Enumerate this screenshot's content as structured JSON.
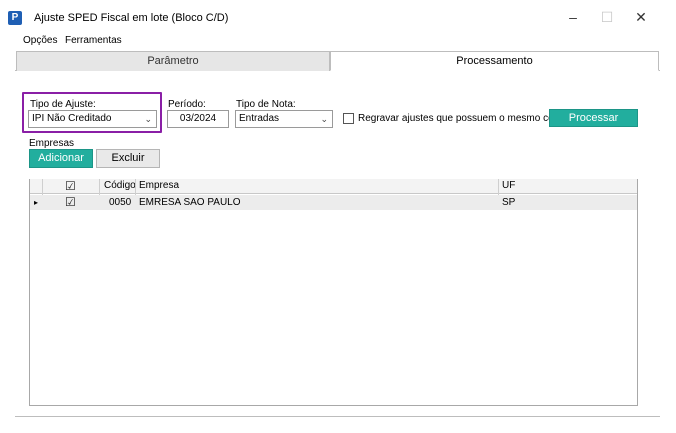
{
  "window": {
    "title": "Ajuste SPED Fiscal em lote (Bloco C/D)",
    "icon_glyph": "P",
    "controls": {
      "minimize": "–",
      "maximize": "☐",
      "close": "✕"
    }
  },
  "menu": {
    "items": [
      "Opções",
      "Ferramentas"
    ]
  },
  "tabs": [
    {
      "label": "Parâmetro",
      "active": false
    },
    {
      "label": "Processamento",
      "active": true
    }
  ],
  "form": {
    "tipo_ajuste": {
      "label": "Tipo de Ajuste:",
      "value": "IPI Não Creditado"
    },
    "periodo": {
      "label": "Período:",
      "value": "03/2024"
    },
    "tipo_nota": {
      "label": "Tipo de Nota:",
      "value": "Entradas"
    },
    "regravar": {
      "label": "Regravar ajustes que possuem o mesmo código",
      "checked": false
    },
    "processar_label": "Processar"
  },
  "empresas": {
    "label": "Empresas",
    "adicionar_label": "Adicionar",
    "excluir_label": "Excluir",
    "columns": {
      "check": "☑",
      "codigo": "Código",
      "empresa": "Empresa",
      "uf": "UF"
    },
    "rows": [
      {
        "indicator": "▸",
        "check": "☑",
        "codigo": "0050",
        "empresa": "EMRESA SAO PAULO",
        "uf": "SP"
      }
    ]
  },
  "colors": {
    "accent": "#22ae9e",
    "highlight": "#8a1fa6"
  }
}
